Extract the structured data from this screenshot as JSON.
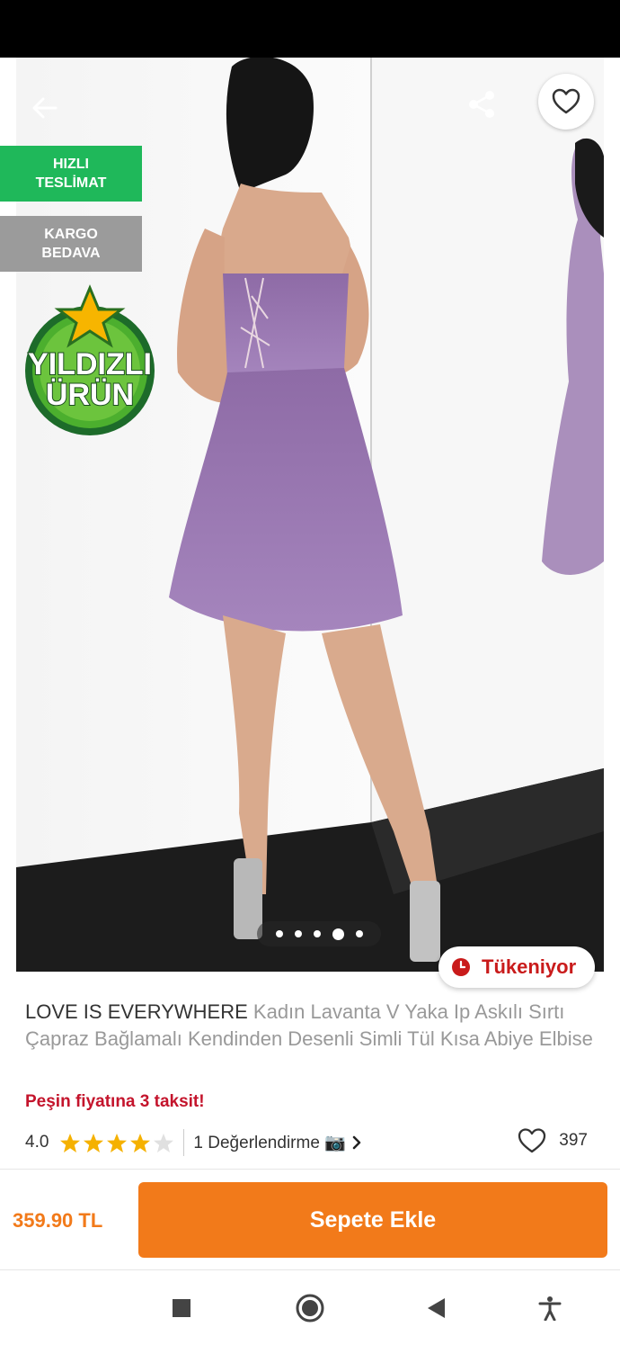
{
  "gallery": {
    "back_icon": "arrow-left-icon",
    "share_icon": "share-icon",
    "favorite_icon": "heart-outline-icon",
    "badges": {
      "fast_delivery": "HIZLI\nTESLİMAT",
      "free_cargo": "KARGO\nBEDAVA"
    },
    "star_product": {
      "line1": "YILDIZLI",
      "line2": "ÜRÜN"
    },
    "image_count": 5,
    "active_image_index": 3,
    "stock_label": "Tükeniyor",
    "stock_icon": "clock-icon"
  },
  "product": {
    "brand": "LOVE IS EVERYWHERE",
    "name": "Kadın Lavanta V Yaka Ip Askılı Sırtı Çapraz Bağlamalı Kendinden Desenli Simli Tül Kısa Abiye Elbise",
    "installment": "Peşin fiyatına 3 taksit!",
    "rating": {
      "value": "4.0",
      "stars_filled": 4,
      "stars_total": 5
    },
    "reviews_label": "1 Değerlendirme 📷",
    "favorite_count": "397"
  },
  "footer": {
    "price": "359.90 TL",
    "add_to_cart": "Sepete Ekle"
  },
  "system_nav": {
    "icons": [
      "recents-square-icon",
      "home-circle-icon",
      "back-triangle-icon",
      "accessibility-icon"
    ]
  },
  "colors": {
    "accent": "#f27a1a",
    "fast_badge": "#1fb85a",
    "cargo_badge": "#9b9b9b",
    "installment": "#c4142c",
    "star": "#f5b100",
    "dress": "#9a7bb0"
  }
}
